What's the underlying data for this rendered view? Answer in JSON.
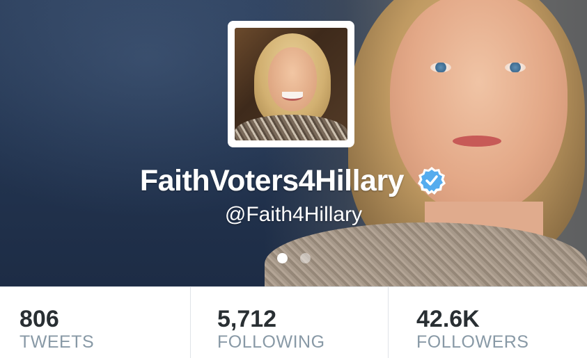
{
  "profile": {
    "display_name": "FaithVoters4Hillary",
    "handle": "@Faith4Hillary",
    "verified": true,
    "verified_icon": "verified-badge-icon",
    "avatar_alt": "profile photo",
    "banner_pages": 2,
    "banner_active_page": 1
  },
  "stats": [
    {
      "value": "806",
      "label": "TWEETS"
    },
    {
      "value": "5,712",
      "label": "FOLLOWING"
    },
    {
      "value": "42.6K",
      "label": "FOLLOWERS"
    }
  ],
  "colors": {
    "header_background": "#233551",
    "verified_blue": "#55acee",
    "stat_value": "#292f33",
    "stat_label": "#8899a6"
  }
}
